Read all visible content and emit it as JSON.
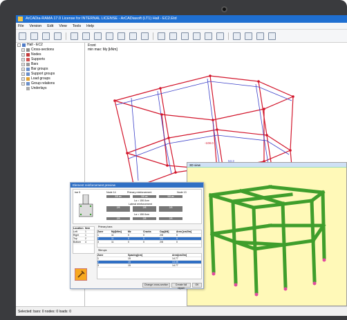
{
  "window": {
    "title": "ArCADia-RAMA 17.0 License for INTERNAL LICENSE - ArCADiasoft (LT1) Hall - EC2.Etd"
  },
  "menu": [
    "File",
    "Version",
    "Edit",
    "View",
    "Tools",
    "Help"
  ],
  "tree": {
    "root": "Hall - EC2",
    "items": [
      "Cross-sections",
      "Nodes",
      "Supports",
      "Bars",
      "Bar groups",
      "Support groups",
      "Load groups",
      "Group relations",
      "Underlays"
    ]
  },
  "view": {
    "label1": "Front",
    "label2": "min max: My [kNm]",
    "value1": "-108.0",
    "value2": "53.3"
  },
  "dialog": {
    "title": "Element reinforcement preview",
    "bar_label": "bar 5",
    "node_left": "Node 14",
    "node_right": "Node 13",
    "primary_header": "Primary reinforcement",
    "secondary_header": "Lateral reinforcement",
    "len1": "La = 150.0cm",
    "len2": "La = 150.0cm",
    "rbar_top": [
      "3/8 øc",
      "3/8 øc",
      "3/8 øc"
    ],
    "rbar_mid": [
      "2/8",
      "2/8",
      "2/8"
    ],
    "rbar_bot": [
      "2/8",
      "2/8",
      "2/8"
    ],
    "loc_headers": [
      "Location",
      "Item"
    ],
    "loc_rows": [
      [
        "Left",
        "1"
      ],
      [
        "Right",
        "1"
      ],
      [
        "Top",
        "2"
      ],
      [
        "Bottom",
        "4"
      ]
    ],
    "primary_label": "Primary bars",
    "stirrups_label": "Stirrups",
    "main_headers": [
      "Zone",
      "My[kNm]",
      "Mz",
      "Cracks",
      "Cap[kN]",
      "Area [cm2/m]"
    ],
    "main_rows": [
      [
        "1",
        "11",
        "0",
        "0",
        "2/8",
        "0"
      ],
      [
        "2",
        "11",
        "0",
        "0",
        "2/8",
        "0"
      ],
      [
        "3",
        "11",
        "0",
        "0",
        "2/8",
        "0"
      ]
    ],
    "stir_headers": [
      "Zone",
      "Spacing[cm]",
      "Area[cm2/m]"
    ],
    "stir_rows": [
      [
        "1",
        "15",
        "14.77"
      ],
      [
        "2",
        "15",
        "13.05"
      ],
      [
        "3",
        "15",
        "14.77"
      ]
    ],
    "buttons": [
      "Change cross-section",
      "Create full report",
      "OK"
    ]
  },
  "panel3d": {
    "title": "3D view"
  },
  "status": "Selected: bars: 0  nodes: 0  loads: 0",
  "colors": {
    "frame_red": "#d2142a",
    "frame_blue": "#3a3fc8",
    "steel_green": "#3f9e2c",
    "node_pink": "#e24aa0",
    "bg_3d": "#fffbbc"
  }
}
